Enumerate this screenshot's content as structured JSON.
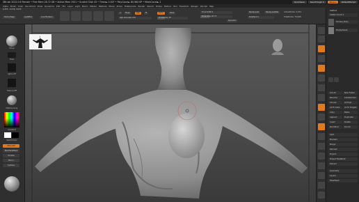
{
  "title_bar": {
    "text": "ZBrush 2022.0.6   Female   • Free Mem 28.72 GB • Active Mem 1921 • Scratch Disk 43 • Timer► 0.007 • PolyCount► 80.984 KP • MeshCount► 2",
    "quicksave": "QuickSave",
    "see_through": "See-through  0",
    "menus": "Menus",
    "default_zscript": "DefaultZScript"
  },
  "menu_bar": [
    "Alpha",
    "Brush",
    "Color",
    "Document",
    "Draw",
    "Dynamics",
    "Edit",
    "File",
    "Layer",
    "Light",
    "Macro",
    "Marker",
    "Material",
    "Movie",
    "Picker",
    "Preferences",
    "Render",
    "Stencil",
    "Stroke",
    "Texture",
    "Tool",
    "Transform",
    "Zplugin",
    "Zscript",
    "Help"
  ],
  "coords": "0.455, -0.576, 0.032",
  "shelf": {
    "home_page": "Home Page",
    "lightbox": "LightBox",
    "live_boolean": "Live Boolean",
    "a_label": "A",
    "mrgb": "Mrgb",
    "rgb": "Rgb",
    "m": "M",
    "zadd": "Zadd",
    "zsub": "Zsub",
    "rgb_intensity": "Rgb Intensity 100",
    "z_intensity": "Z Intensity 25",
    "focal_shift": "Focal Shift 0",
    "draw_size": "Draw Size 28.73",
    "dynamic": "Dynamic",
    "replay_last": "ReplayLast",
    "replay_last_rel": "ReplayLastRel",
    "active_points": "ActivePoints: 2,074",
    "total_points": "TotalPoints: 76,908",
    "polypaint_label": "PolyPaint",
    "polypaint_value": "PolyPaint 1"
  },
  "left_shelf": {
    "move": "Move",
    "dots": "Dots",
    "alpha_off": "Alpha Off",
    "texture_off": "Texture Off",
    "matcap_gray": "MatCap Gray",
    "gradient": "Gradient",
    "switch_color": "SwitchColor",
    "alternate": "Alternate",
    "backface_mask": "BackfaceMask",
    "double": "Double",
    "mirror": "Mirror",
    "surface": "Surface"
  },
  "tray": {
    "subtool": "Subtool",
    "visible_count": "Visible Count 2",
    "female_body": "Female_Body",
    "polysphere": "PolySphere1",
    "list_all": "List All",
    "new_folder": "New Folder",
    "rename": "Rename",
    "auto_reorder": "AutoReorder",
    "all_low": "All Low",
    "all_high": "All High",
    "all_to_subs": "All To Subs",
    "all_to_targets": "All To Targets",
    "copy": "Copy",
    "paste": "Paste",
    "append": "Append",
    "duplicate": "Duplicate",
    "insert": "Insert",
    "delete": "Delete",
    "del_other": "Del Other",
    "del_all": "Del All",
    "split": "Split",
    "boolean": "Boolean",
    "merge": "Merge",
    "remesh": "Remesh",
    "project": "Project",
    "project_base_relief": "Project BasRelief",
    "extract": "Extract",
    "geometry": "Geometry",
    "layers": "Layers",
    "fibermesh": "FiberMesh"
  },
  "colors": {
    "accent_orange": "#e07a1f",
    "panel_dark": "#2b2b2b",
    "viewport_gray": "#4f4f4f"
  }
}
